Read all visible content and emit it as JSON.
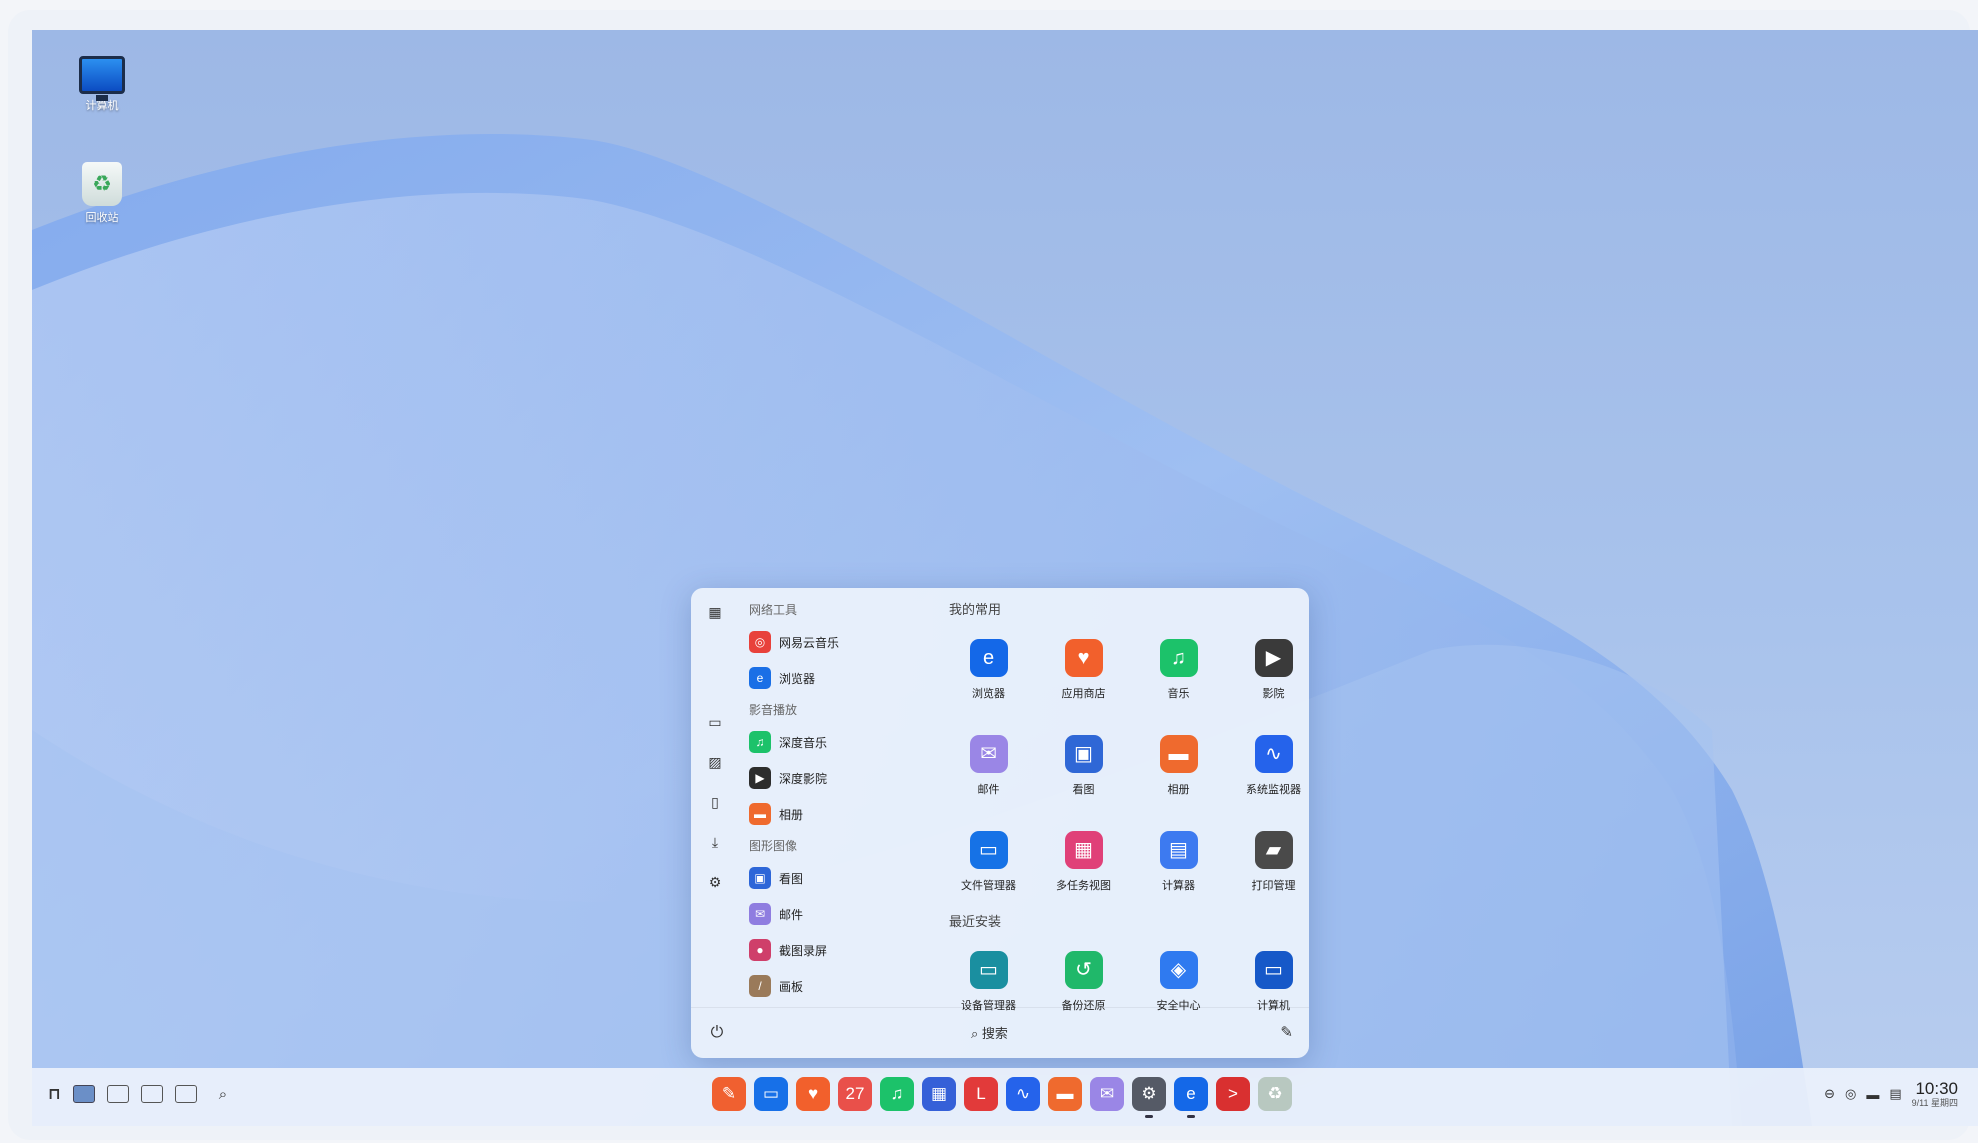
{
  "desktop": {
    "icons": [
      {
        "label": "计算机"
      },
      {
        "label": "回收站"
      }
    ]
  },
  "start_menu": {
    "sidebar_groups": [
      {
        "title": "网络工具",
        "items": [
          {
            "label": "网易云音乐",
            "color": "#e8413b",
            "glyph": "◎"
          },
          {
            "label": "浏览器",
            "color": "#1a6fe6",
            "glyph": "e"
          }
        ]
      },
      {
        "title": "影音播放",
        "items": [
          {
            "label": "深度音乐",
            "color": "#1cc26a",
            "glyph": "♫"
          },
          {
            "label": "深度影院",
            "color": "#2d2d2d",
            "glyph": "▶"
          },
          {
            "label": "相册",
            "color": "#ef6a2e",
            "glyph": "▬"
          }
        ]
      },
      {
        "title": "图形图像",
        "items": [
          {
            "label": "看图",
            "color": "#2d66d8",
            "glyph": "▣"
          },
          {
            "label": "邮件",
            "color": "#8f7de0",
            "glyph": "✉"
          },
          {
            "label": "截图录屏",
            "color": "#cf3f6a",
            "glyph": "●"
          },
          {
            "label": "画板",
            "color": "#9a7a5a",
            "glyph": "/"
          }
        ]
      }
    ],
    "favorites_title": "我的常用",
    "favorites": [
      {
        "label": "浏览器",
        "color": "#1468e8",
        "glyph": "e"
      },
      {
        "label": "应用商店",
        "color": "#f2602c",
        "glyph": "♥"
      },
      {
        "label": "音乐",
        "color": "#1cc26a",
        "glyph": "♫"
      },
      {
        "label": "影院",
        "color": "#3a3a3a",
        "glyph": "▶"
      },
      {
        "label": "邮件",
        "color": "#9a86e6",
        "glyph": "✉"
      },
      {
        "label": "看图",
        "color": "#2f67d6",
        "glyph": "▣"
      },
      {
        "label": "相册",
        "color": "#ef6a2e",
        "glyph": "▬"
      },
      {
        "label": "系统监视器",
        "color": "#2563eb",
        "glyph": "∿"
      },
      {
        "label": "文件管理器",
        "color": "#1672e6",
        "glyph": "▭"
      },
      {
        "label": "多任务视图",
        "color": "#e04078",
        "glyph": "▦"
      },
      {
        "label": "计算器",
        "color": "#3d7af0",
        "glyph": "▤"
      },
      {
        "label": "打印管理",
        "color": "#4a4a4a",
        "glyph": "▰"
      }
    ],
    "recent_title": "最近安装",
    "recent": [
      {
        "label": "设备管理器",
        "color": "#1a8fa0",
        "glyph": "▭"
      },
      {
        "label": "备份还原",
        "color": "#20b86a",
        "glyph": "↺"
      },
      {
        "label": "安全中心",
        "color": "#2f7af0",
        "glyph": "◈"
      },
      {
        "label": "计算机",
        "color": "#1658c8",
        "glyph": "▭"
      }
    ],
    "rail_icons": [
      "apps-icon",
      "document-icon",
      "picture-icon",
      "file-icon",
      "download-icon",
      "settings-icon"
    ],
    "search_placeholder": "搜索",
    "power_glyph": "⏻",
    "edit_glyph": "✎"
  },
  "taskbar": {
    "search_glyph": "⌕",
    "dock": [
      {
        "name": "file-manager-app",
        "color": "#f06030",
        "glyph": "✎",
        "running": false
      },
      {
        "name": "folder-app",
        "color": "#1770e8",
        "glyph": "▭",
        "running": false
      },
      {
        "name": "app-store-app",
        "color": "#f2602c",
        "glyph": "♥",
        "running": false
      },
      {
        "name": "calendar-app",
        "color": "#e9504a",
        "glyph": "27",
        "running": false
      },
      {
        "name": "music-app",
        "color": "#1cc26a",
        "glyph": "♫",
        "running": false
      },
      {
        "name": "launchpad-app",
        "color": "#3560d8",
        "glyph": "▦",
        "running": false
      },
      {
        "name": "contacts-app",
        "color": "#e23a3a",
        "glyph": "L",
        "running": false
      },
      {
        "name": "system-monitor-app",
        "color": "#2563eb",
        "glyph": "∿",
        "running": false
      },
      {
        "name": "photos-app",
        "color": "#ef6a2e",
        "glyph": "▬",
        "running": false
      },
      {
        "name": "mail-app",
        "color": "#9a86e6",
        "glyph": "✉",
        "running": false
      },
      {
        "name": "settings-app",
        "color": "#555a66",
        "glyph": "⚙",
        "running": true
      },
      {
        "name": "browser-app",
        "color": "#1468e8",
        "glyph": "e",
        "running": true
      },
      {
        "name": "terminal-app",
        "color": "#d93030",
        "glyph": ">",
        "running": false
      },
      {
        "name": "trash-app",
        "color": "#b8c8c0",
        "glyph": "♻",
        "running": false
      }
    ],
    "clock_time": "10:30",
    "clock_date": "9/11 星期四"
  }
}
